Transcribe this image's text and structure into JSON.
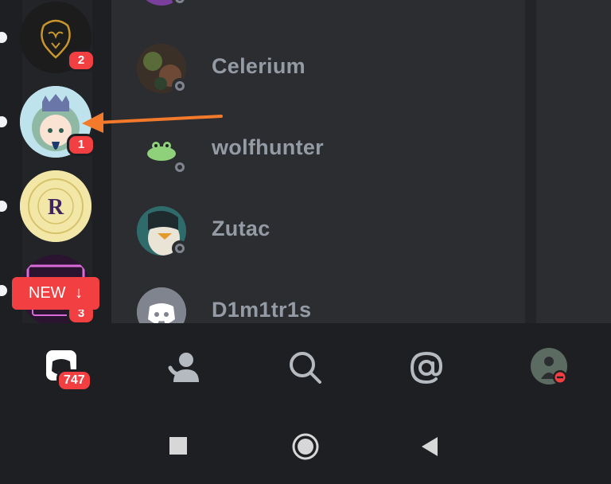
{
  "servers": [
    {
      "badge": "2"
    },
    {
      "badge": "1"
    },
    {
      "badge": ""
    },
    {
      "badge": "3"
    }
  ],
  "new_button": {
    "label": "NEW",
    "arrow": "↓"
  },
  "members": [
    {
      "name": "Celerium"
    },
    {
      "name": "wolfhunter"
    },
    {
      "name": "Zutac"
    },
    {
      "name": "D1m1tr1s"
    }
  ],
  "bottom_nav": {
    "home_badge": "747",
    "icons": [
      "discord-home-icon",
      "friends-icon",
      "search-icon",
      "mentions-icon",
      "profile-avatar"
    ]
  },
  "system_nav": {
    "icons": [
      "recents-square-icon",
      "home-circle-icon",
      "back-triangle-icon"
    ]
  },
  "colors": {
    "background": "#1e1f22",
    "panel": "#2b2d31",
    "badge_red": "#f23f42",
    "annotation_arrow": "#f47a2b",
    "muted_text": "#949ba4"
  }
}
